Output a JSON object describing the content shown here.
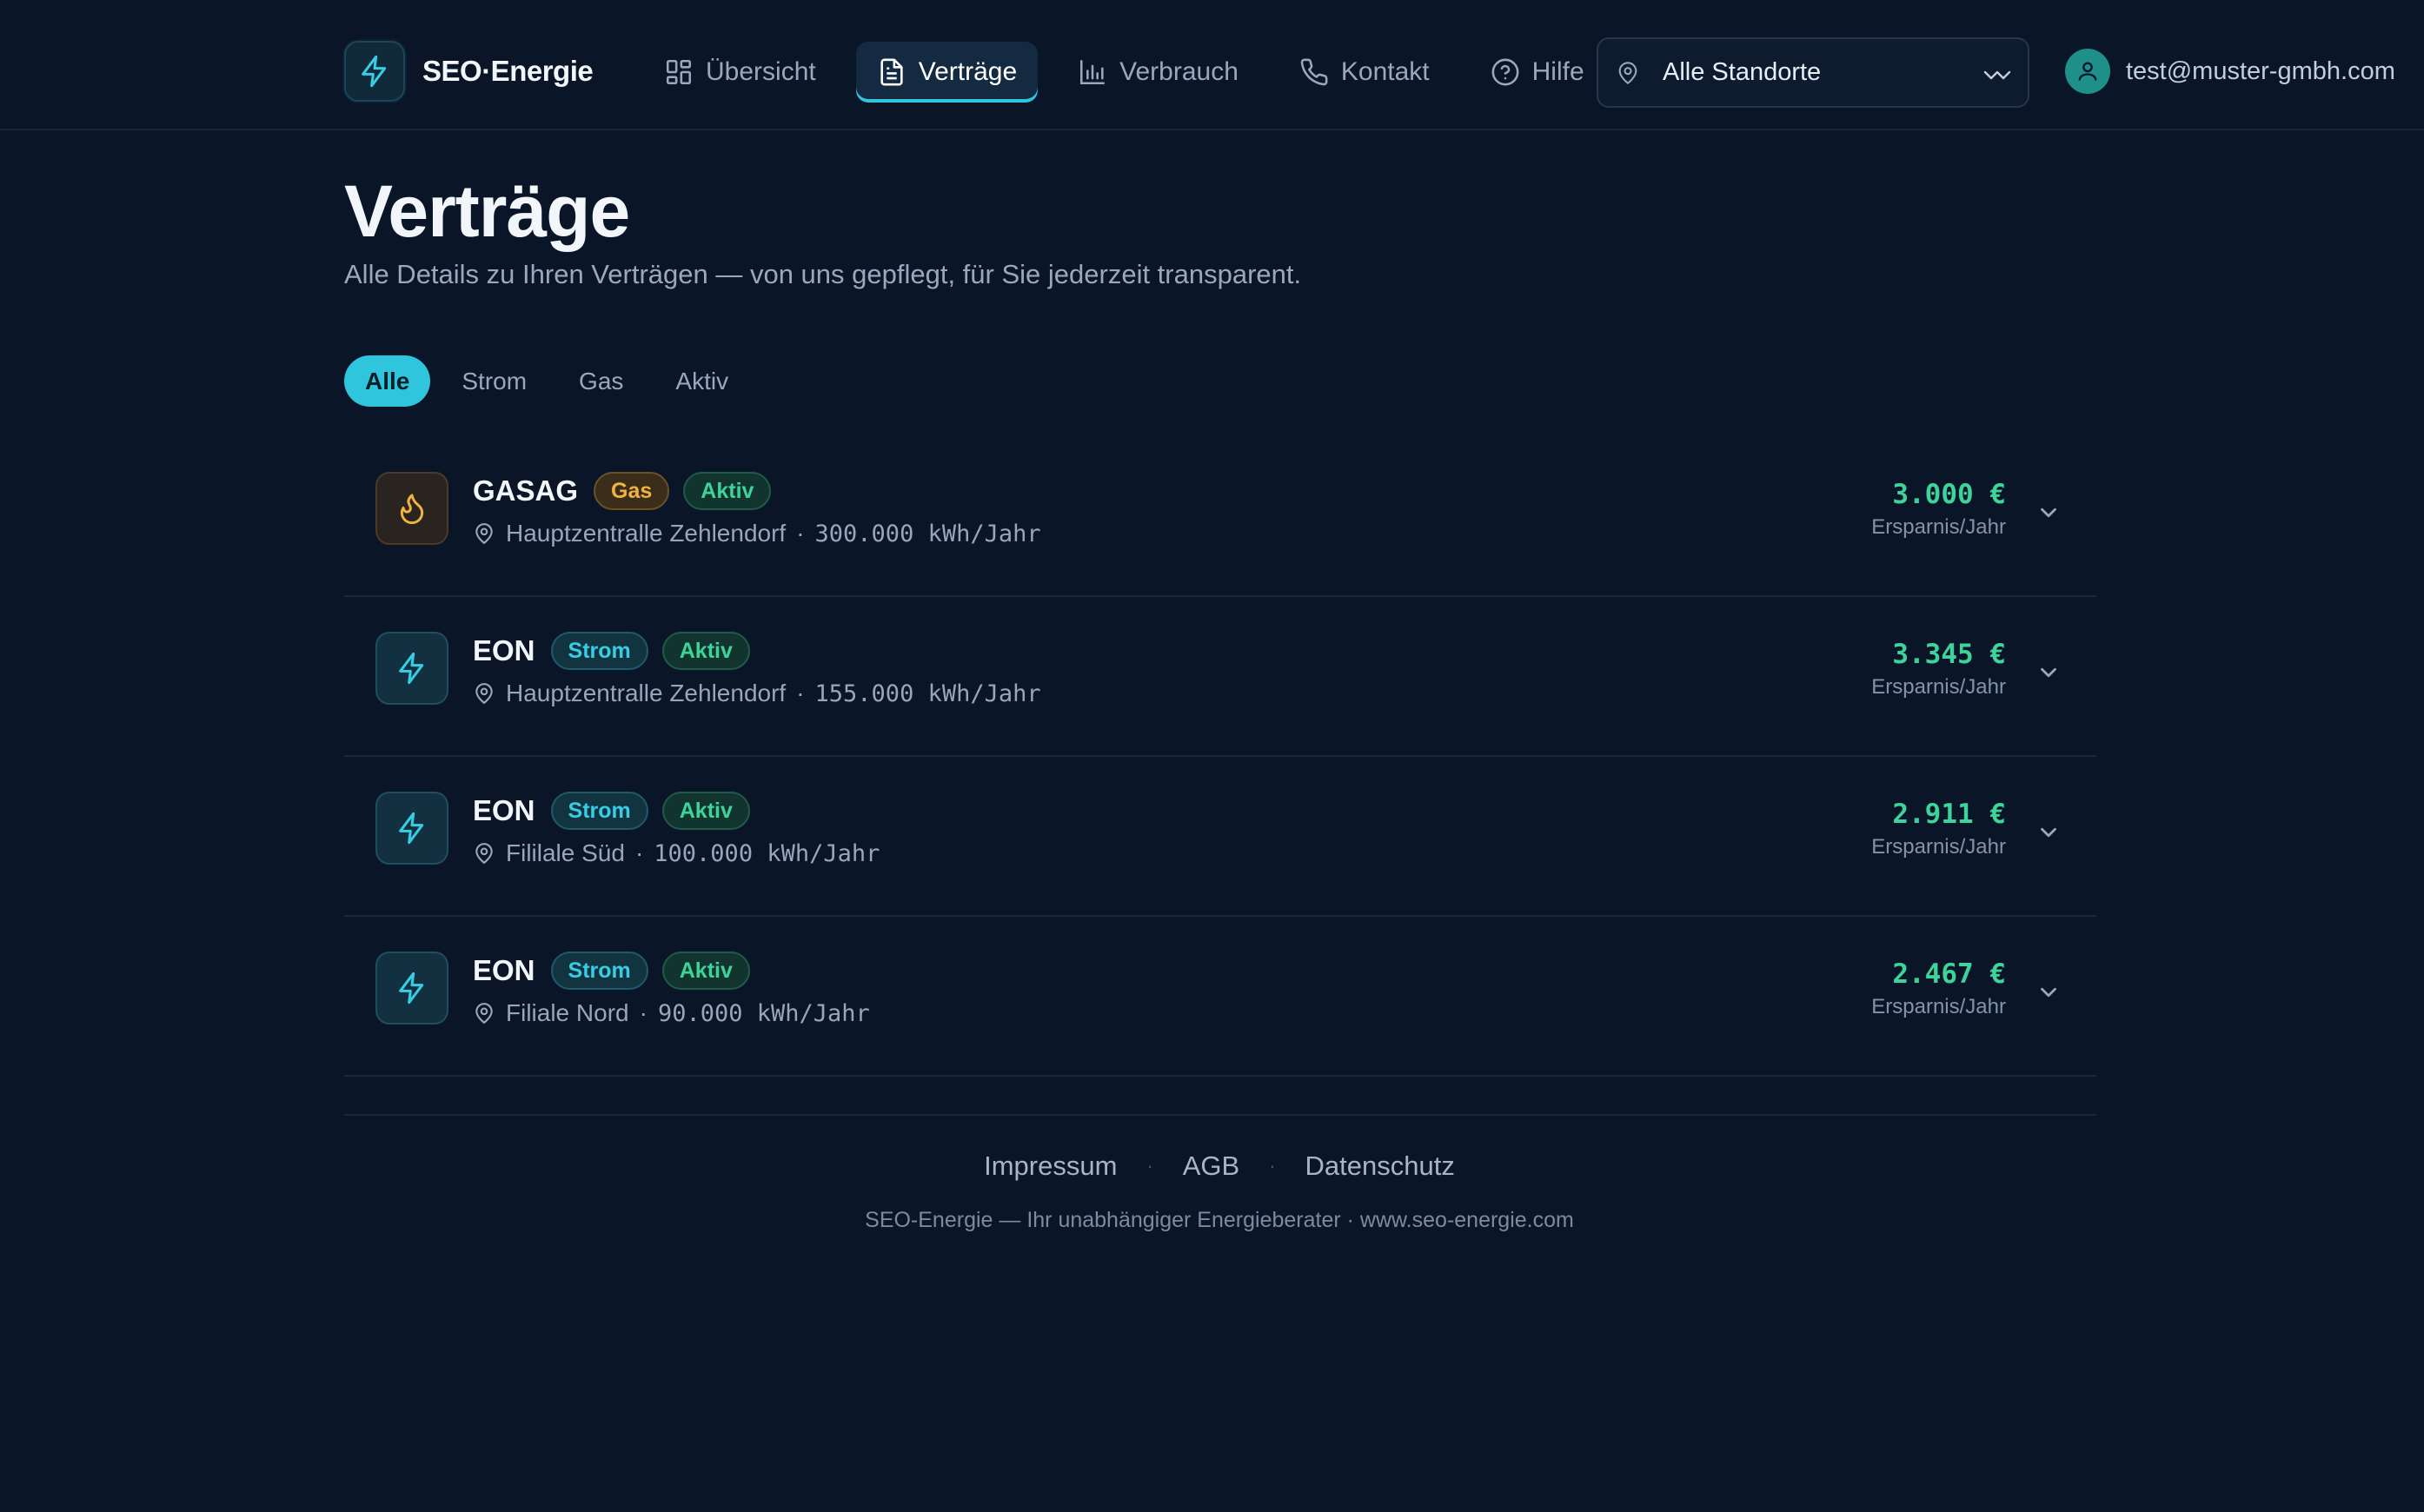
{
  "brand": {
    "name": "SEO·Energie",
    "icon": "bolt-icon",
    "accent": "#2fc5dc"
  },
  "nav": {
    "items": [
      {
        "label": "Übersicht",
        "icon": "grid-icon",
        "active": false
      },
      {
        "label": "Verträge",
        "icon": "document-icon",
        "active": true
      },
      {
        "label": "Verbrauch",
        "icon": "bar-chart-icon",
        "active": false
      },
      {
        "label": "Kontakt",
        "icon": "phone-icon",
        "active": false
      },
      {
        "label": "Hilfe",
        "icon": "help-circle-icon",
        "active": false
      }
    ]
  },
  "location_select": {
    "value": "Alle Standorte",
    "icon": "map-pin-icon"
  },
  "user": {
    "email": "test@muster-gmbh.com",
    "icon": "user-icon"
  },
  "page": {
    "title": "Verträge",
    "subtitle": "Alle Details zu Ihren Verträgen — von uns gepflegt, für Sie jederzeit transparent."
  },
  "filters": [
    {
      "label": "Alle",
      "active": true
    },
    {
      "label": "Strom",
      "active": false
    },
    {
      "label": "Gas",
      "active": false
    },
    {
      "label": "Aktiv",
      "active": false
    }
  ],
  "contracts": [
    {
      "provider": "GASAG",
      "type": "Gas",
      "type_icon": "flame-icon",
      "status": "Aktiv",
      "location": "Hauptzentralle Zehlendorf",
      "consumption": "300.000 kWh/Jahr",
      "saving": "3.000 €",
      "saving_label": "Ersparnis/Jahr"
    },
    {
      "provider": "EON",
      "type": "Strom",
      "type_icon": "bolt-icon",
      "status": "Aktiv",
      "location": "Hauptzentralle Zehlendorf",
      "consumption": "155.000 kWh/Jahr",
      "saving": "3.345 €",
      "saving_label": "Ersparnis/Jahr"
    },
    {
      "provider": "EON",
      "type": "Strom",
      "type_icon": "bolt-icon",
      "status": "Aktiv",
      "location": "Fililale Süd",
      "consumption": "100.000 kWh/Jahr",
      "saving": "2.911 €",
      "saving_label": "Ersparnis/Jahr"
    },
    {
      "provider": "EON",
      "type": "Strom",
      "type_icon": "bolt-icon",
      "status": "Aktiv",
      "location": "Filiale Nord",
      "consumption": "90.000 kWh/Jahr",
      "saving": "2.467 €",
      "saving_label": "Ersparnis/Jahr"
    }
  ],
  "footer": {
    "links": [
      "Impressum",
      "AGB",
      "Datenschutz"
    ],
    "separator": "·",
    "meta_separator": "·",
    "copy": "SEO-Energie — Ihr unabhängiger Energieberater · www.seo-energie.com"
  },
  "colors": {
    "background": "#0a1628",
    "success": "#3ed39a",
    "gas": "#f0b340",
    "strom": "#37cde4"
  }
}
